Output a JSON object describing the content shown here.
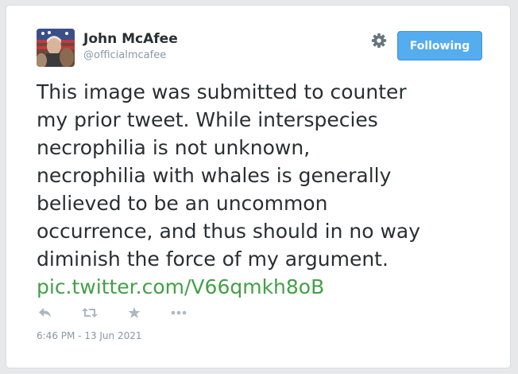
{
  "user": {
    "name": "John McAfee",
    "handle": "@officialmcafee"
  },
  "follow_button": {
    "label": "Following",
    "color": "#55acee"
  },
  "tweet": {
    "lines": [
      "This image was submitted to counter",
      "my prior tweet. While interspecies",
      "necrophilia is not unknown,",
      "necrophilia with whales is generally",
      "believed to be an uncommon",
      "occurrence, and thus should in no way",
      "diminish the force of my argument."
    ],
    "link": "pic.twitter.com/V66qmkh8oB",
    "link_color": "#43a047"
  },
  "actions": [
    "reply-icon",
    "retweet-icon",
    "favorite-icon",
    "more-icon"
  ],
  "timestamp": "6:46 PM - 13 Jun 2021"
}
